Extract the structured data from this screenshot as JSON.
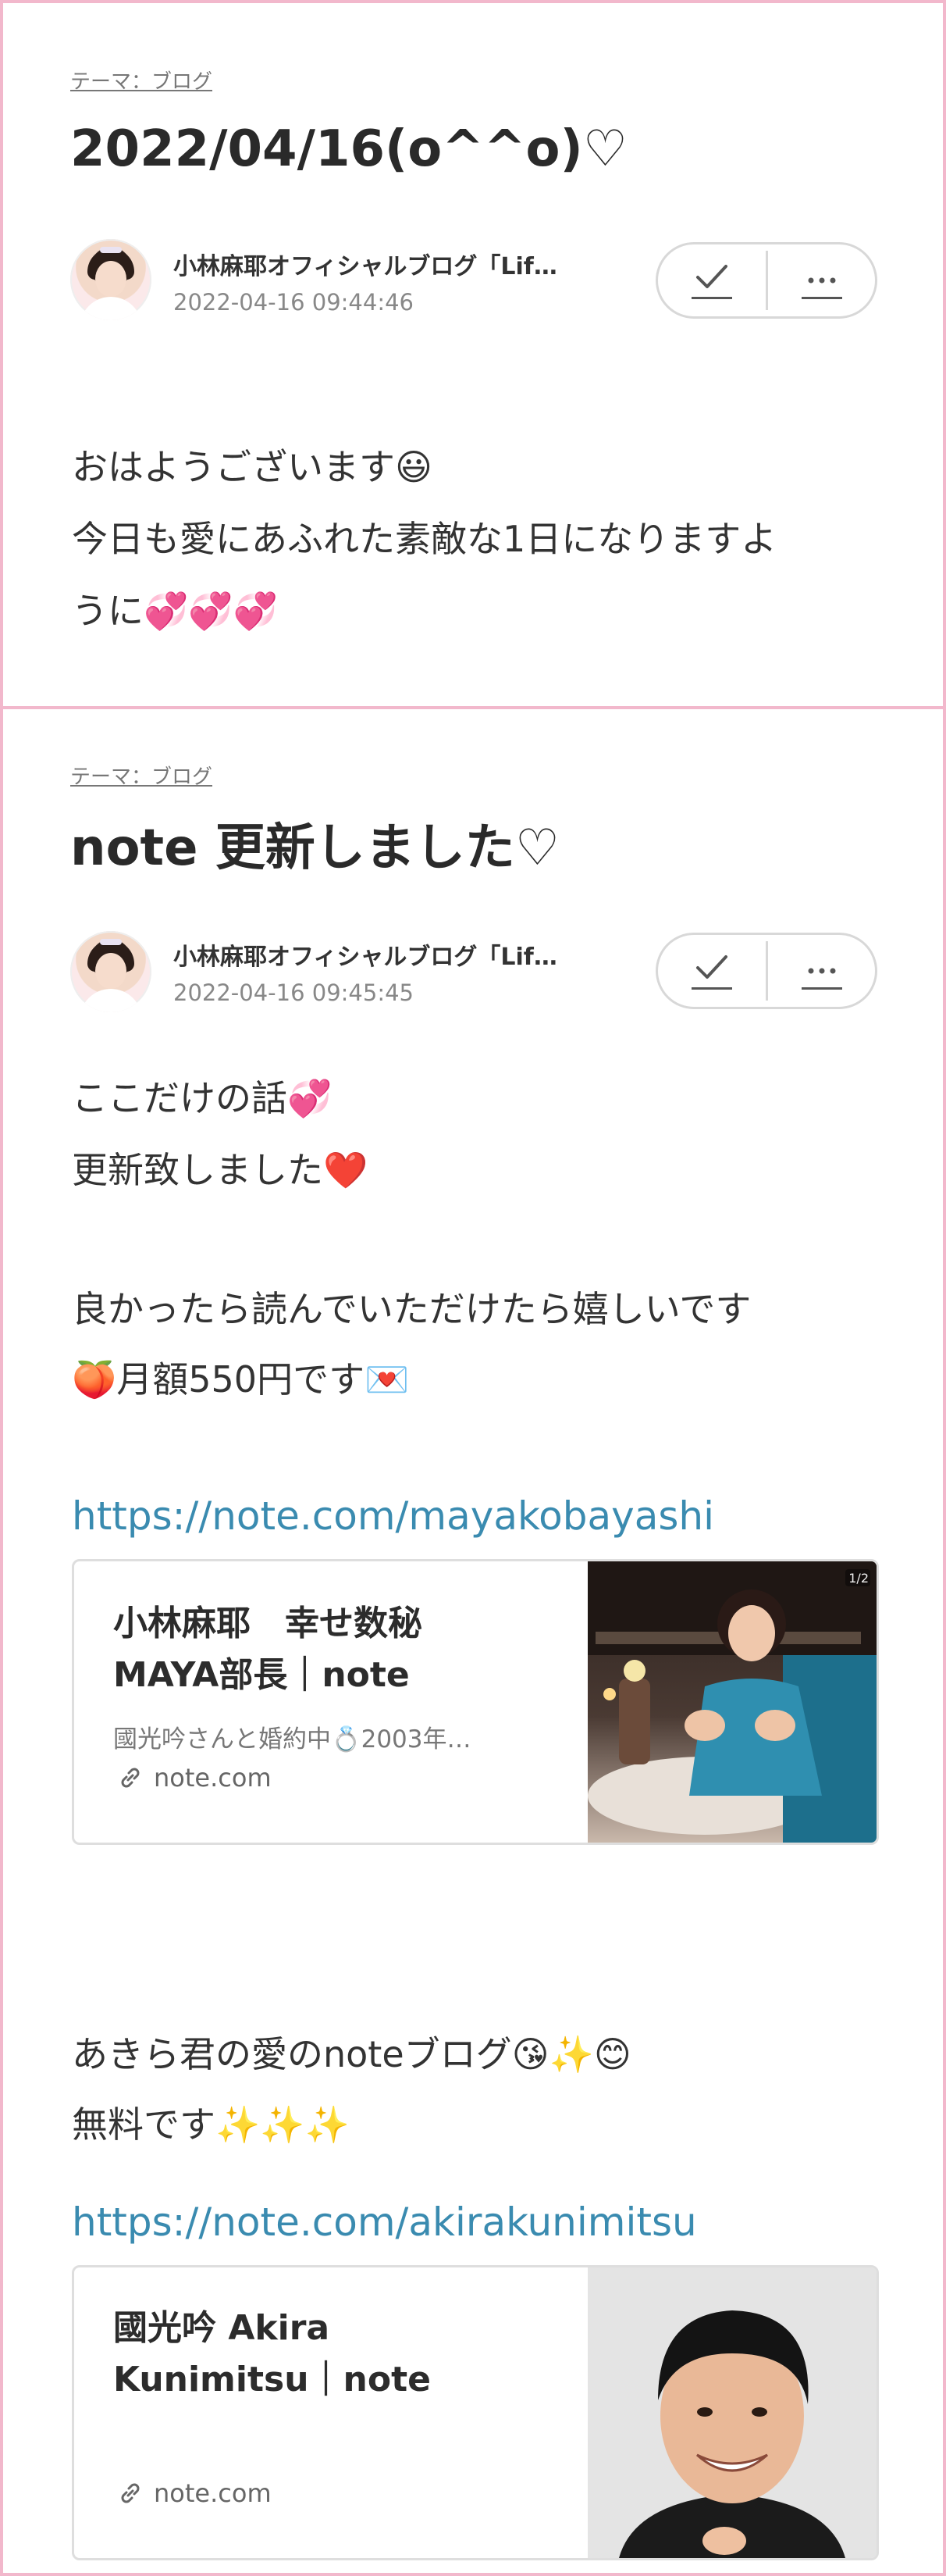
{
  "colors": {
    "frame": "#f2b8cc",
    "link": "#3a8bb0",
    "text": "#333333",
    "muted": "#888888"
  },
  "posts": [
    {
      "theme": "テーマ：ブログ",
      "title": "2022/04/16(o^^o)♡",
      "author": "小林麻耶オフィシャルブログ「Lif…",
      "date": "2022-04-16 09:44:46",
      "lines": [
        "おはようございます😃",
        "今日も愛にあふれた素敵な1日になりますよ",
        "うに💞💞💞"
      ]
    },
    {
      "theme": "テーマ：ブログ",
      "title": "note 更新しました♡",
      "author": "小林麻耶オフィシャルブログ「Lif…",
      "date": "2022-04-16 09:45:45",
      "lines": [
        "ここだけの話💞",
        "更新致しました❤️",
        "良かったら読んでいただけたら嬉しいです",
        "🍑月額550円です💌"
      ],
      "link1": "https://note.com/mayakobayashi",
      "card1": {
        "title_line1": "小林麻耶　幸せ数秘",
        "title_line2": "MAYA部長｜note",
        "desc": "國光吟さんと婚約中💍2003年…",
        "domain": "note.com",
        "badge": "1/2"
      },
      "lines2": [
        "あきら君の愛のnoteブログ😘✨😊",
        "無料です✨✨✨"
      ],
      "link2": "https://note.com/akirakunimitsu",
      "card2": {
        "title_line1": "國光吟 Akira",
        "title_line2": "Kunimitsu｜note",
        "domain": "note.com"
      }
    }
  ],
  "icons": {
    "check": "check-icon",
    "more": "more-icon",
    "link": "link-icon"
  }
}
